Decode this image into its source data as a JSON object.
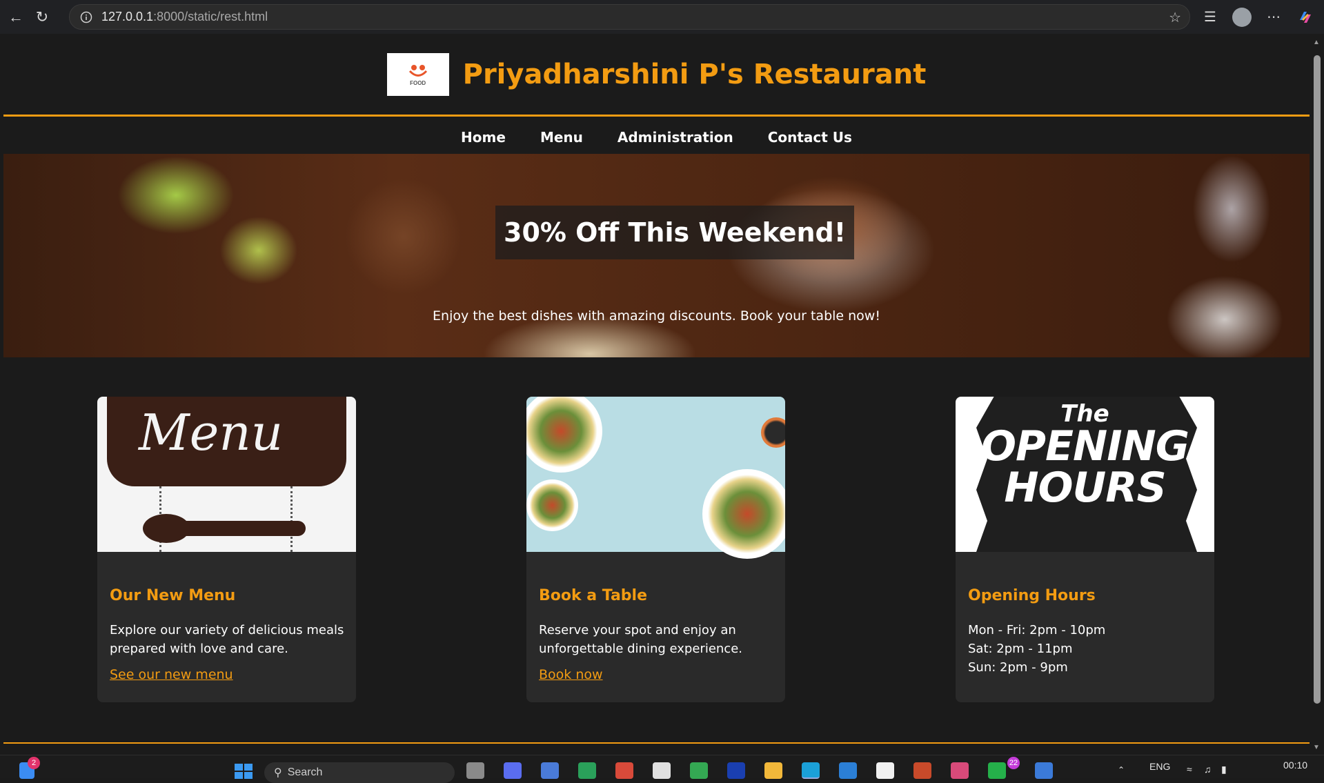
{
  "browser": {
    "url_host": "127.0.0.1",
    "url_path": ":8000/static/rest.html"
  },
  "site": {
    "title": "Priyadharshini P's Restaurant",
    "logo_text": "FOOD",
    "accent_color": "#f39c12"
  },
  "nav": {
    "items": [
      {
        "label": "Home"
      },
      {
        "label": "Menu"
      },
      {
        "label": "Administration"
      },
      {
        "label": "Contact Us"
      }
    ]
  },
  "hero": {
    "title": "30% Off This Weekend!",
    "subtitle": "Enjoy the best dishes with amazing discounts. Book your table now!"
  },
  "cards": [
    {
      "image_word": "Menu",
      "title": "Our New Menu",
      "text": "Explore our variety of delicious meals prepared with love and care.",
      "link": "See our new menu"
    },
    {
      "title": "Book a Table",
      "text": "Reserve your spot and enjoy an unforgettable dining experience.",
      "link": "Book now"
    },
    {
      "image_the": "The",
      "image_line1": "OPENING",
      "image_line2": "HOURS",
      "title": "Opening Hours",
      "hours": [
        "Mon - Fri: 2pm - 10pm",
        "Sat: 2pm - 11pm",
        "Sun: 2pm - 9pm"
      ]
    }
  ],
  "taskbar": {
    "search_placeholder": "Search",
    "notif_count": "2",
    "whatsapp_count": "22",
    "language": "ENG",
    "time": "00:10"
  }
}
